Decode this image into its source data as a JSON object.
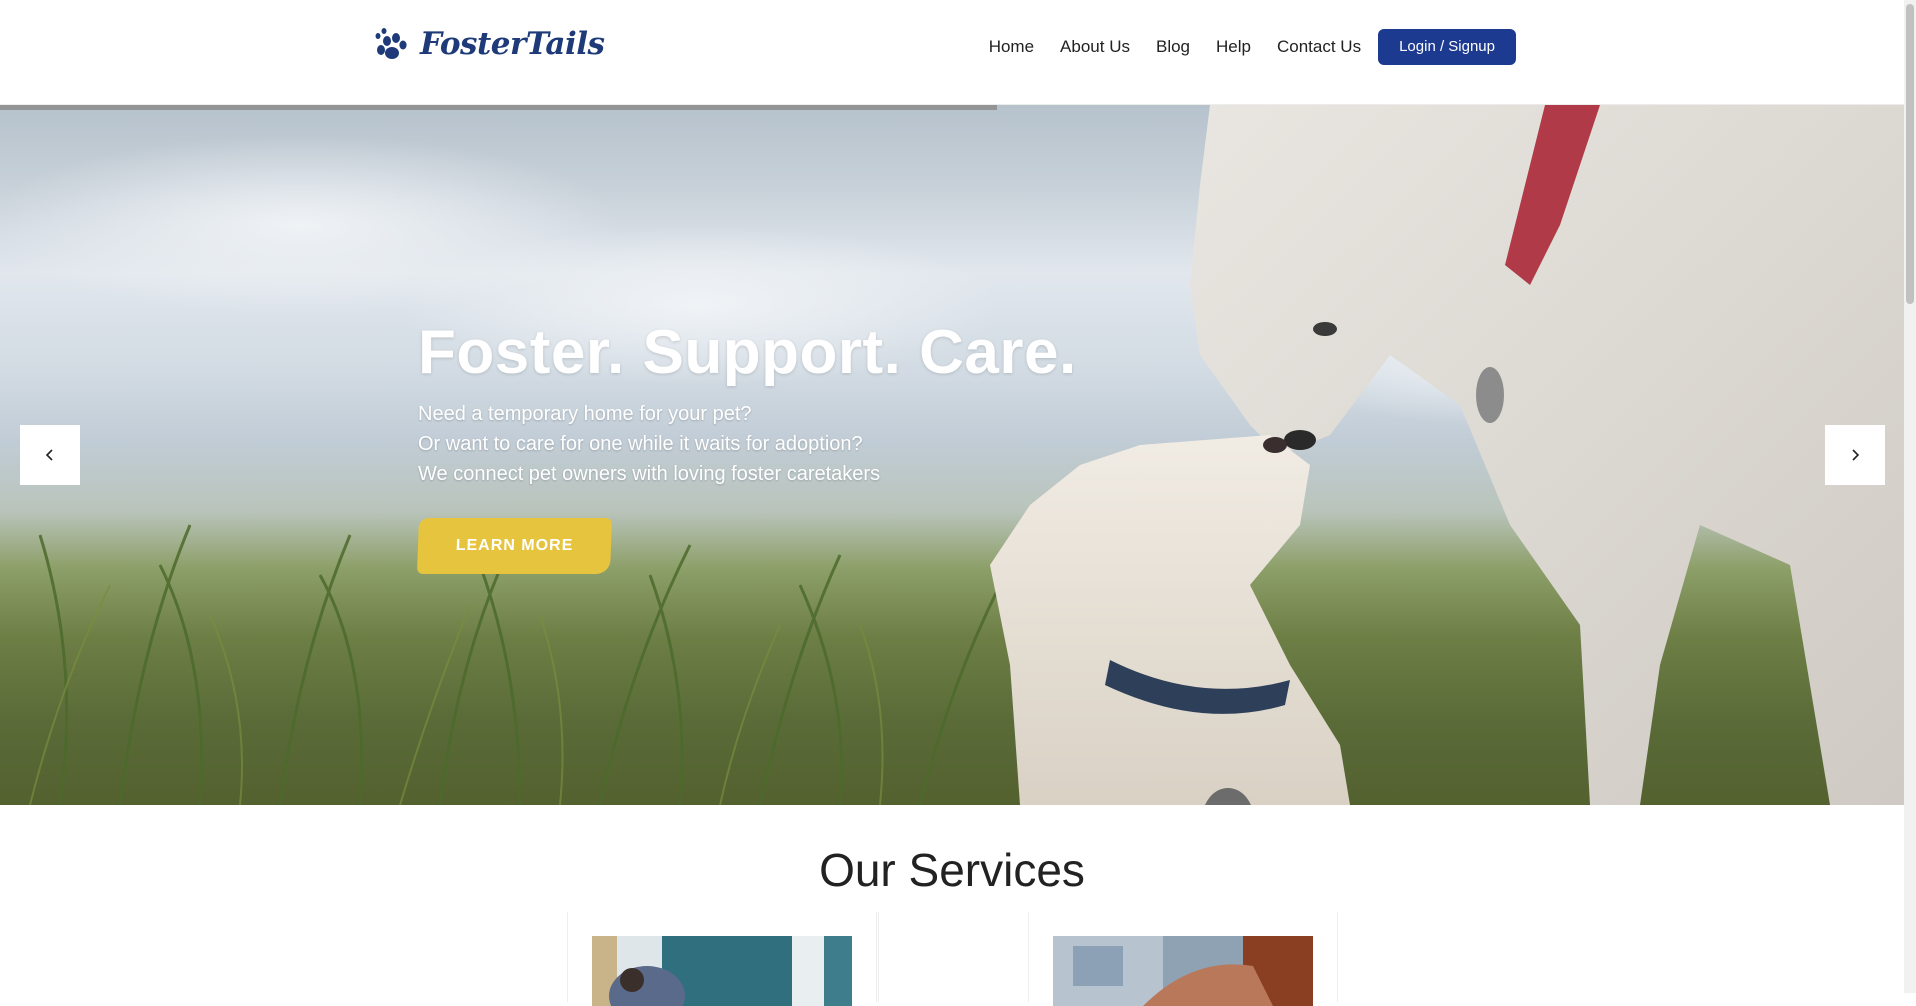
{
  "brand": {
    "name": "FosterTails",
    "icon": "paw-icon",
    "color": "#1e3a78"
  },
  "nav": {
    "items": [
      "Home",
      "About Us",
      "Blog",
      "Help",
      "Contact Us"
    ],
    "login_label": "Login / Signup",
    "login_color": "#1c3a8f"
  },
  "hero": {
    "title": "Foster. Support. Care.",
    "lines": [
      "Need a temporary home for your pet?",
      "Or want to care for one while it waits for adoption?",
      "We connect pet owners with loving foster caretakers"
    ],
    "cta_label": "LEARN MORE",
    "cta_color": "#e6c43e",
    "prev_icon": "chevron-left-icon",
    "next_icon": "chevron-right-icon"
  },
  "services": {
    "title": "Our Services"
  }
}
